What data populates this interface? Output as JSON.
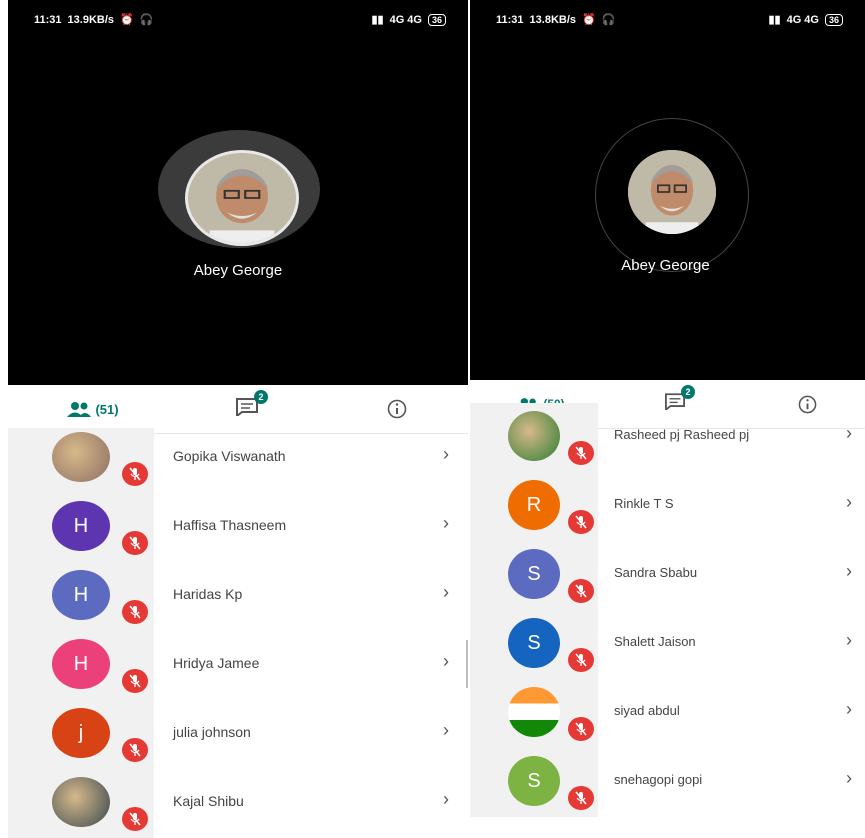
{
  "left": {
    "status": {
      "time": "11:31",
      "speed": "13.9KB/s",
      "network": "4G 4G",
      "battery": "36"
    },
    "speaker": {
      "name": "Abey George"
    },
    "tabs": {
      "people_count": "(51)",
      "chat_badge": "2"
    },
    "participants": [
      {
        "name": "Gopika Viswanath",
        "initial": "",
        "color": "#8d6e63"
      },
      {
        "name": "Haffisa Thasneem",
        "initial": "H",
        "color": "#5e35b1"
      },
      {
        "name": "Haridas Kp",
        "initial": "H",
        "color": "#5c6bc0"
      },
      {
        "name": "Hridya Jamee",
        "initial": "H",
        "color": "#ec407a"
      },
      {
        "name": "julia johnson",
        "initial": "j",
        "color": "#d84315"
      },
      {
        "name": "Kajal Shibu",
        "initial": "",
        "color": "#37474f"
      }
    ]
  },
  "right": {
    "status": {
      "time": "11:31",
      "speed": "13.8KB/s",
      "network": "4G 4G",
      "battery": "36"
    },
    "speaker": {
      "name": "Abey George"
    },
    "tabs": {
      "people_count": "(50)",
      "chat_badge": "2"
    },
    "participants": [
      {
        "name": "Rasheed pj Rasheed pj",
        "initial": "",
        "color": "#2e7d32"
      },
      {
        "name": "Rinkle T S",
        "initial": "R",
        "color": "#ef6c00"
      },
      {
        "name": "Sandra Sbabu",
        "initial": "S",
        "color": "#5c6bc0"
      },
      {
        "name": "Shalett Jaison",
        "initial": "S",
        "color": "#1565c0"
      },
      {
        "name": "siyad abdul",
        "initial": "",
        "color": "#ffffff"
      },
      {
        "name": "snehagopi gopi",
        "initial": "S",
        "color": "#7cb342"
      }
    ]
  },
  "colors": {
    "accent": "#00796b",
    "mute": "#e53935"
  }
}
